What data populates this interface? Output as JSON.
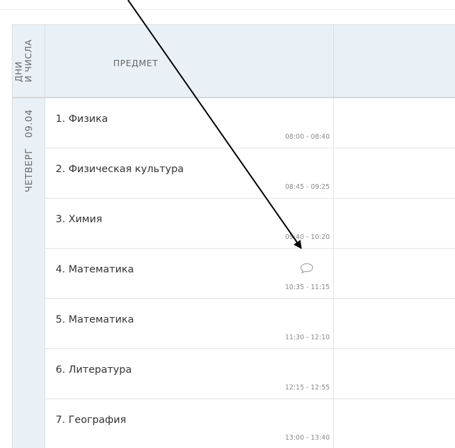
{
  "header": {
    "days_label_line1": "ДНИ",
    "days_label_line2": "И ЧИСЛА",
    "subject_label": "ПРЕДМЕТ"
  },
  "day": {
    "weekday": "ЧЕТВЕРГ",
    "date": "09.04"
  },
  "lessons": [
    {
      "name": "1. Физика",
      "time": "08:00 - 08:40"
    },
    {
      "name": "2. Физическая культура",
      "time": "08:45 - 09:25"
    },
    {
      "name": "3. Химия",
      "time": "09:40 - 10:20"
    },
    {
      "name": "4. Математика",
      "time": "10:35 - 11:15",
      "comment_icon": "comment-bubble-icon"
    },
    {
      "name": "5. Математика",
      "time": "11:30 - 12:10"
    },
    {
      "name": "6. Литература",
      "time": "12:15 - 12:55"
    },
    {
      "name": "7. География",
      "time": "13:00 - 13:40"
    }
  ],
  "annotation": {
    "type": "arrow",
    "color": "#000000"
  }
}
